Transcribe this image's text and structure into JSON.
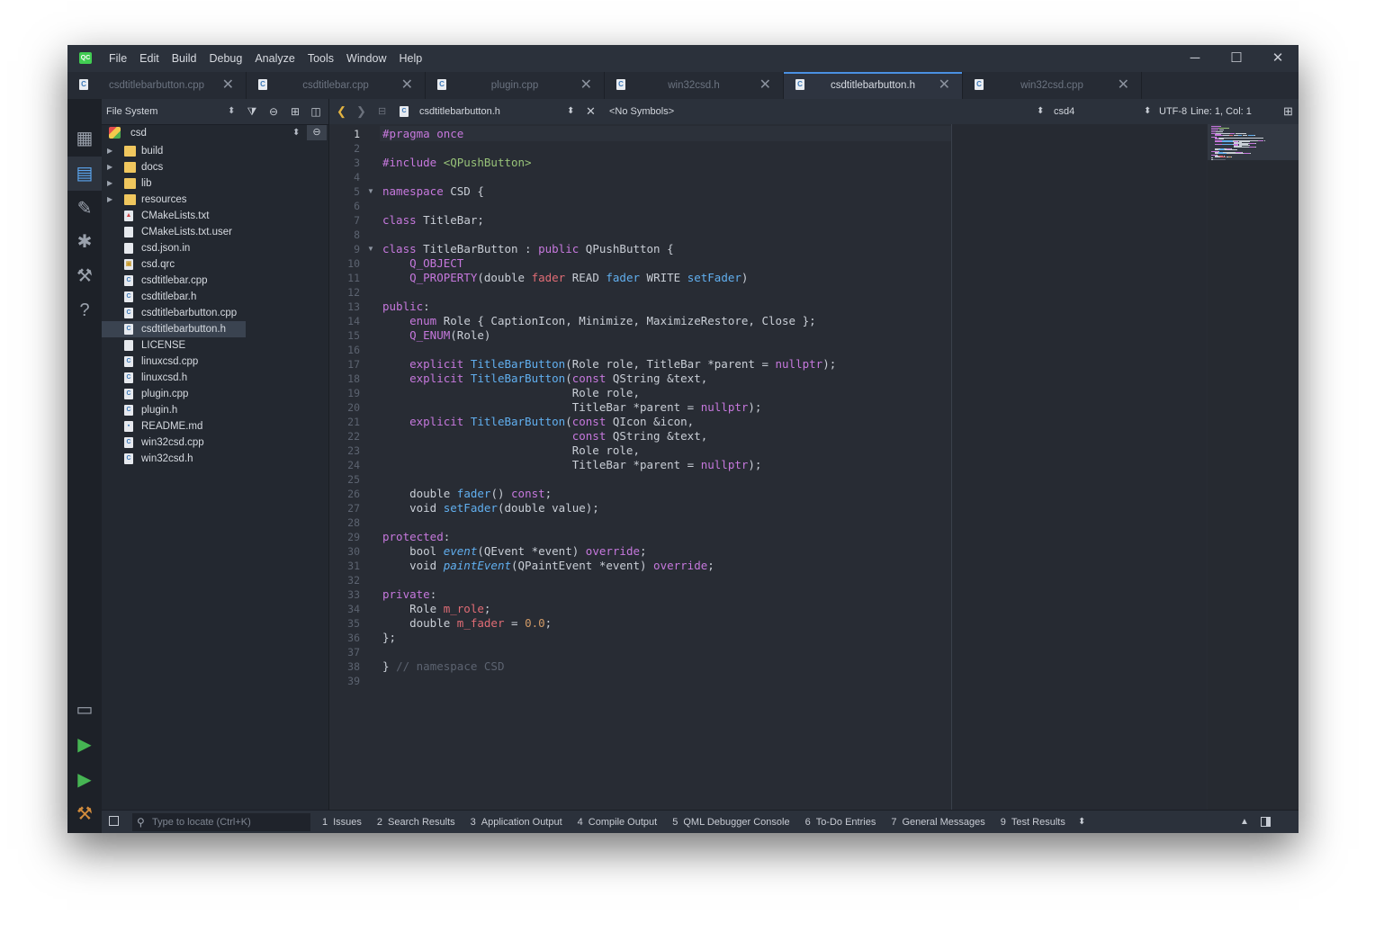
{
  "menu": {
    "app_logo": "QC",
    "items": [
      "File",
      "Edit",
      "Build",
      "Debug",
      "Analyze",
      "Tools",
      "Window",
      "Help"
    ]
  },
  "window_controls": {
    "minimize": "─",
    "maximize": "☐",
    "close": "✕"
  },
  "tabs": [
    {
      "label": "csdtitlebarbutton.cpp",
      "active": false
    },
    {
      "label": "csdtitlebar.cpp",
      "active": false
    },
    {
      "label": "plugin.cpp",
      "active": false
    },
    {
      "label": "win32csd.h",
      "active": false
    },
    {
      "label": "csdtitlebarbutton.h",
      "active": true
    },
    {
      "label": "win32csd.cpp",
      "active": false
    }
  ],
  "file_panel": {
    "title": "File System",
    "root": "csd",
    "items": [
      {
        "label": "build",
        "type": "folder"
      },
      {
        "label": "docs",
        "type": "folder"
      },
      {
        "label": "lib",
        "type": "folder"
      },
      {
        "label": "resources",
        "type": "folder"
      },
      {
        "label": "CMakeLists.txt",
        "type": "cmake"
      },
      {
        "label": "CMakeLists.txt.user",
        "type": "file"
      },
      {
        "label": "csd.json.in",
        "type": "file"
      },
      {
        "label": "csd.qrc",
        "type": "qrc"
      },
      {
        "label": "csdtitlebar.cpp",
        "type": "cpp"
      },
      {
        "label": "csdtitlebar.h",
        "type": "h"
      },
      {
        "label": "csdtitlebarbutton.cpp",
        "type": "cpp"
      },
      {
        "label": "csdtitlebarbutton.h",
        "type": "h",
        "selected": true
      },
      {
        "label": "LICENSE",
        "type": "file"
      },
      {
        "label": "linuxcsd.cpp",
        "type": "cpp"
      },
      {
        "label": "linuxcsd.h",
        "type": "h"
      },
      {
        "label": "plugin.cpp",
        "type": "cpp"
      },
      {
        "label": "plugin.h",
        "type": "h"
      },
      {
        "label": "README.md",
        "type": "md"
      },
      {
        "label": "win32csd.cpp",
        "type": "cpp"
      },
      {
        "label": "win32csd.h",
        "type": "h"
      }
    ]
  },
  "editor_toolbar": {
    "file": "csdtitlebarbutton.h",
    "symbols": "<No Symbols>",
    "kit": "csd4",
    "encoding": "UTF-8",
    "position": "Line: 1, Col: 1"
  },
  "code_lines": [
    [
      [
        "#pragma once",
        "#c678dd"
      ]
    ],
    [],
    [
      [
        "#include ",
        "#c678dd"
      ],
      [
        "<QPushButton>",
        "#98c379"
      ]
    ],
    [],
    [
      [
        "namespace",
        "#c678dd"
      ],
      [
        " CSD {",
        "#c9ced6"
      ]
    ],
    [],
    [
      [
        "class",
        "#c678dd"
      ],
      [
        " TitleBar;",
        "#c9ced6"
      ]
    ],
    [],
    [
      [
        "class",
        "#c678dd"
      ],
      [
        " TitleBarButton : ",
        "#c9ced6"
      ],
      [
        "public",
        "#c678dd"
      ],
      [
        " QPushButton {",
        "#c9ced6"
      ]
    ],
    [
      [
        "    Q_OBJECT",
        "#c678dd"
      ]
    ],
    [
      [
        "    Q_PROPERTY",
        "#c678dd"
      ],
      [
        "(double ",
        "#c9ced6"
      ],
      [
        "fader",
        "#e06c75"
      ],
      [
        " READ ",
        "#c9ced6"
      ],
      [
        "fader",
        "#61afef"
      ],
      [
        " WRITE ",
        "#c9ced6"
      ],
      [
        "setFader",
        "#61afef"
      ],
      [
        ")",
        "#c9ced6"
      ]
    ],
    [],
    [
      [
        "public",
        "#c678dd"
      ],
      [
        ":",
        "#c9ced6"
      ]
    ],
    [
      [
        "    enum",
        "#c678dd"
      ],
      [
        " Role { CaptionIcon, Minimize, MaximizeRestore, Close };",
        "#c9ced6"
      ]
    ],
    [
      [
        "    Q_ENUM",
        "#c678dd"
      ],
      [
        "(Role)",
        "#c9ced6"
      ]
    ],
    [],
    [
      [
        "    explicit ",
        "#c678dd"
      ],
      [
        "TitleBarButton",
        "#61afef"
      ],
      [
        "(Role role, TitleBar *parent = ",
        "#c9ced6"
      ],
      [
        "nullptr",
        "#c678dd"
      ],
      [
        ");",
        "#c9ced6"
      ]
    ],
    [
      [
        "    explicit ",
        "#c678dd"
      ],
      [
        "TitleBarButton",
        "#61afef"
      ],
      [
        "(",
        "#c9ced6"
      ],
      [
        "const",
        "#c678dd"
      ],
      [
        " QString &text,",
        "#c9ced6"
      ]
    ],
    [
      [
        "                            Role role,",
        "#c9ced6"
      ]
    ],
    [
      [
        "                            TitleBar *parent = ",
        "#c9ced6"
      ],
      [
        "nullptr",
        "#c678dd"
      ],
      [
        ");",
        "#c9ced6"
      ]
    ],
    [
      [
        "    explicit ",
        "#c678dd"
      ],
      [
        "TitleBarButton",
        "#61afef"
      ],
      [
        "(",
        "#c9ced6"
      ],
      [
        "const",
        "#c678dd"
      ],
      [
        " QIcon &icon,",
        "#c9ced6"
      ]
    ],
    [
      [
        "                            ",
        "#c9ced6"
      ],
      [
        "const",
        "#c678dd"
      ],
      [
        " QString &text,",
        "#c9ced6"
      ]
    ],
    [
      [
        "                            Role role,",
        "#c9ced6"
      ]
    ],
    [
      [
        "                            TitleBar *parent = ",
        "#c9ced6"
      ],
      [
        "nullptr",
        "#c678dd"
      ],
      [
        ");",
        "#c9ced6"
      ]
    ],
    [],
    [
      [
        "    double ",
        "#c9ced6"
      ],
      [
        "fader",
        "#61afef"
      ],
      [
        "() ",
        "#c9ced6"
      ],
      [
        "const",
        "#c678dd"
      ],
      [
        ";",
        "#c9ced6"
      ]
    ],
    [
      [
        "    void ",
        "#c9ced6"
      ],
      [
        "setFader",
        "#61afef"
      ],
      [
        "(double value);",
        "#c9ced6"
      ]
    ],
    [],
    [
      [
        "protected",
        "#c678dd"
      ],
      [
        ":",
        "#c9ced6"
      ]
    ],
    [
      [
        "    bool ",
        "#c9ced6"
      ],
      [
        "event",
        "#61afef"
      ],
      [
        "(QEvent *event) ",
        "#c9ced6"
      ],
      [
        "override",
        "#c678dd"
      ],
      [
        ";",
        "#c9ced6"
      ]
    ],
    [
      [
        "    void ",
        "#c9ced6"
      ],
      [
        "paintEvent",
        "#61afef"
      ],
      [
        "(QPaintEvent *event) ",
        "#c9ced6"
      ],
      [
        "override",
        "#c678dd"
      ],
      [
        ";",
        "#c9ced6"
      ]
    ],
    [],
    [
      [
        "private",
        "#c678dd"
      ],
      [
        ":",
        "#c9ced6"
      ]
    ],
    [
      [
        "    Role ",
        "#c9ced6"
      ],
      [
        "m_role",
        "#e06c75"
      ],
      [
        ";",
        "#c9ced6"
      ]
    ],
    [
      [
        "    double ",
        "#c9ced6"
      ],
      [
        "m_fader",
        "#e06c75"
      ],
      [
        " = ",
        "#c9ced6"
      ],
      [
        "0.0",
        "#d19a66"
      ],
      [
        ";",
        "#c9ced6"
      ]
    ],
    [
      [
        "};",
        "#c9ced6"
      ]
    ],
    [],
    [
      [
        "} ",
        "#c9ced6"
      ],
      [
        "// namespace CSD",
        "#5c6370"
      ]
    ],
    []
  ],
  "bottom": {
    "locator_placeholder": "Type to locate (Ctrl+K)",
    "tabs": [
      {
        "num": "1",
        "label": "Issues"
      },
      {
        "num": "2",
        "label": "Search Results"
      },
      {
        "num": "3",
        "label": "Application Output"
      },
      {
        "num": "4",
        "label": "Compile Output"
      },
      {
        "num": "5",
        "label": "QML Debugger Console"
      },
      {
        "num": "6",
        "label": "To-Do Entries"
      },
      {
        "num": "7",
        "label": "General Messages"
      },
      {
        "num": "9",
        "label": "Test Results"
      }
    ]
  }
}
